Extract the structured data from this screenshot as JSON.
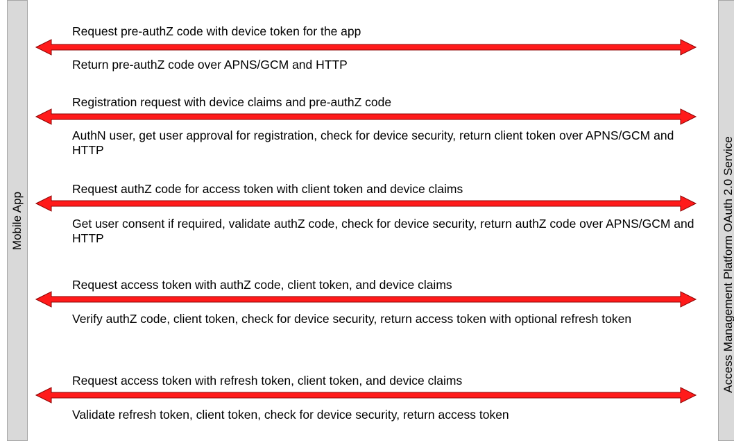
{
  "lanes": {
    "left": "Mobile App",
    "right": "Access Management Platform OAuth 2.0 Service"
  },
  "colors": {
    "arrow_fill": "#ff1a1a",
    "arrow_stroke": "#8b0000",
    "lane": "#d9d9d9"
  },
  "steps": [
    {
      "request": "Request pre-authZ code with device token for the app",
      "response": "Return pre-authZ code over APNS/GCM and HTTP"
    },
    {
      "request": "Registration request with device claims and pre-authZ code",
      "response": "AuthN user, get user approval for registration, check for device security, return client token over APNS/GCM and HTTP"
    },
    {
      "request": "Request authZ code for access token with client token and device claims",
      "response": "Get user consent if required, validate authZ code, check for device security, return authZ code over APNS/GCM and HTTP"
    },
    {
      "request": "Request access token with authZ code, client token, and device claims",
      "response": "Verify authZ code, client token, check for device security, return access token with optional refresh token"
    },
    {
      "request": "Request access token with refresh token, client token, and device claims",
      "response": "Validate refresh token, client token, check for device security, return access token"
    }
  ]
}
